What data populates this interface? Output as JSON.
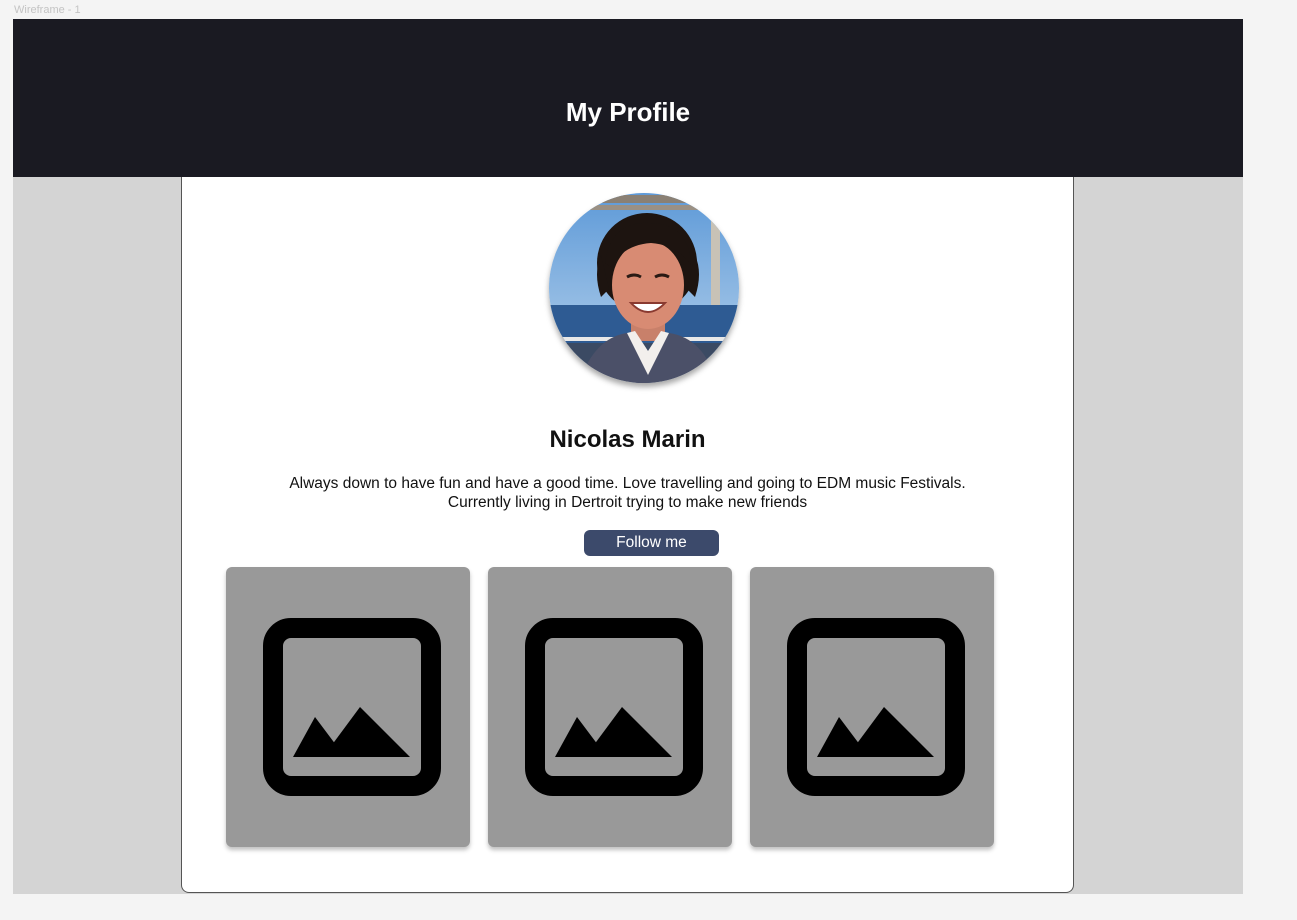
{
  "frame": {
    "label": "Wireframe - 1"
  },
  "header": {
    "title": "My Profile"
  },
  "profile": {
    "avatar_icon": "profile-photo",
    "name": "Nicolas Marin",
    "bio_line1": "Always down to have fun and have a good time. Love travelling and going to EDM music Festivals.",
    "bio_line2": "Currently living in Dertroit trying to make new friends",
    "follow_label": "Follow me"
  },
  "gallery": {
    "items": [
      {
        "icon": "image-placeholder-icon"
      },
      {
        "icon": "image-placeholder-icon"
      },
      {
        "icon": "image-placeholder-icon"
      }
    ]
  },
  "colors": {
    "header_bg": "#1a1a22",
    "frame_bg": "#d4d4d4",
    "card_bg": "#ffffff",
    "button_bg": "#3c4a6b",
    "tile_bg": "#999999"
  }
}
